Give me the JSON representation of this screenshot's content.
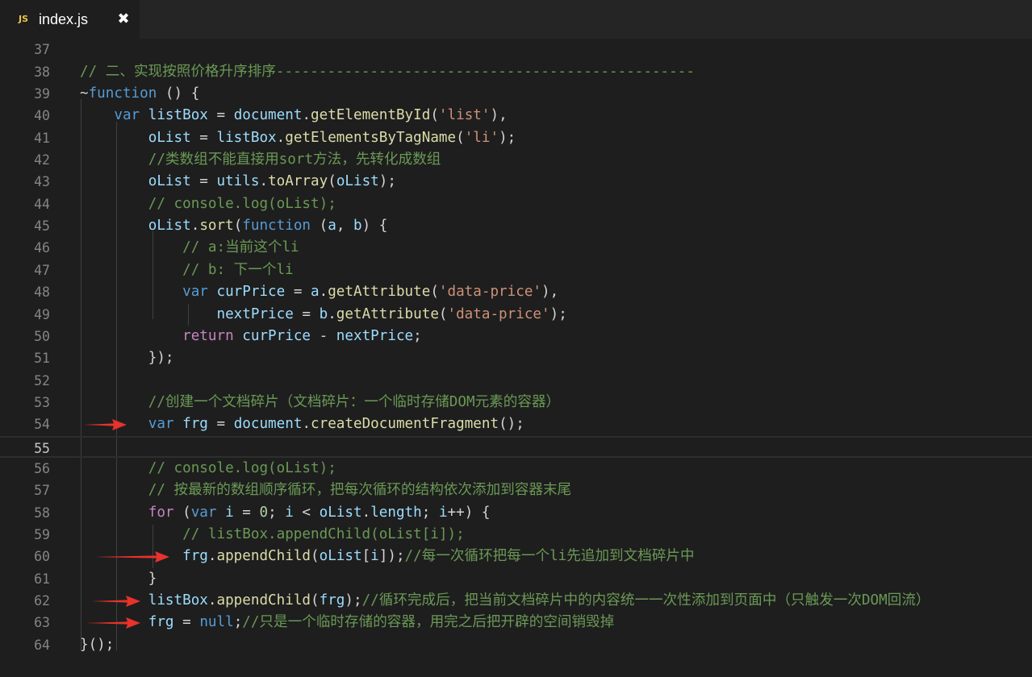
{
  "tab": {
    "icon": "JS",
    "title": "index.js",
    "close": "✖"
  },
  "colors": {
    "background": "#1e1e1e",
    "comment": "#6a9955",
    "keyword": "#569cd6",
    "control": "#c586c0",
    "variable": "#9cdcfe",
    "function": "#dcdcaa",
    "string": "#ce9178",
    "number": "#b5cea8",
    "arrow": "#e8322b"
  },
  "editor": {
    "current_line": 55,
    "arrow_lines": [
      54,
      60,
      62,
      63
    ],
    "lines": [
      {
        "n": "37",
        "tokens": []
      },
      {
        "n": "38",
        "tokens": [
          [
            "cm",
            "// 二、实现按照价格升序排序-------------------------------------------------"
          ]
        ]
      },
      {
        "n": "39",
        "tokens": [
          [
            "pl",
            "~"
          ],
          [
            "kw",
            "function"
          ],
          [
            "pl",
            " () {"
          ]
        ]
      },
      {
        "n": "40",
        "tokens": [
          [
            "pl",
            "    "
          ],
          [
            "kw",
            "var"
          ],
          [
            "pl",
            " "
          ],
          [
            "var",
            "listBox"
          ],
          [
            "pl",
            " = "
          ],
          [
            "var",
            "document"
          ],
          [
            "pl",
            "."
          ],
          [
            "fn",
            "getElementById"
          ],
          [
            "pl",
            "("
          ],
          [
            "str",
            "'list'"
          ],
          [
            "pl",
            "),"
          ]
        ]
      },
      {
        "n": "41",
        "tokens": [
          [
            "pl",
            "        "
          ],
          [
            "var",
            "oList"
          ],
          [
            "pl",
            " = "
          ],
          [
            "var",
            "listBox"
          ],
          [
            "pl",
            "."
          ],
          [
            "fn",
            "getElementsByTagName"
          ],
          [
            "pl",
            "("
          ],
          [
            "str",
            "'li'"
          ],
          [
            "pl",
            ");"
          ]
        ]
      },
      {
        "n": "42",
        "tokens": [
          [
            "pl",
            "        "
          ],
          [
            "cm",
            "//类数组不能直接用sort方法，先转化成数组"
          ]
        ]
      },
      {
        "n": "43",
        "tokens": [
          [
            "pl",
            "        "
          ],
          [
            "var",
            "oList"
          ],
          [
            "pl",
            " = "
          ],
          [
            "var",
            "utils"
          ],
          [
            "pl",
            "."
          ],
          [
            "fn",
            "toArray"
          ],
          [
            "pl",
            "("
          ],
          [
            "var",
            "oList"
          ],
          [
            "pl",
            ");"
          ]
        ]
      },
      {
        "n": "44",
        "tokens": [
          [
            "pl",
            "        "
          ],
          [
            "cm",
            "// console.log(oList);"
          ]
        ]
      },
      {
        "n": "45",
        "tokens": [
          [
            "pl",
            "        "
          ],
          [
            "var",
            "oList"
          ],
          [
            "pl",
            "."
          ],
          [
            "fn",
            "sort"
          ],
          [
            "pl",
            "("
          ],
          [
            "kw",
            "function"
          ],
          [
            "pl",
            " ("
          ],
          [
            "var",
            "a"
          ],
          [
            "pl",
            ", "
          ],
          [
            "var",
            "b"
          ],
          [
            "pl",
            ") {"
          ]
        ]
      },
      {
        "n": "46",
        "tokens": [
          [
            "pl",
            "            "
          ],
          [
            "cm",
            "// a:当前这个li"
          ]
        ]
      },
      {
        "n": "47",
        "tokens": [
          [
            "pl",
            "            "
          ],
          [
            "cm",
            "// b: 下一个li"
          ]
        ]
      },
      {
        "n": "48",
        "tokens": [
          [
            "pl",
            "            "
          ],
          [
            "kw",
            "var"
          ],
          [
            "pl",
            " "
          ],
          [
            "var",
            "curPrice"
          ],
          [
            "pl",
            " = "
          ],
          [
            "var",
            "a"
          ],
          [
            "pl",
            "."
          ],
          [
            "fn",
            "getAttribute"
          ],
          [
            "pl",
            "("
          ],
          [
            "str",
            "'data-price'"
          ],
          [
            "pl",
            "),"
          ]
        ]
      },
      {
        "n": "49",
        "tokens": [
          [
            "pl",
            "                "
          ],
          [
            "var",
            "nextPrice"
          ],
          [
            "pl",
            " = "
          ],
          [
            "var",
            "b"
          ],
          [
            "pl",
            "."
          ],
          [
            "fn",
            "getAttribute"
          ],
          [
            "pl",
            "("
          ],
          [
            "str",
            "'data-price'"
          ],
          [
            "pl",
            ");"
          ]
        ]
      },
      {
        "n": "50",
        "tokens": [
          [
            "pl",
            "            "
          ],
          [
            "ctl",
            "return"
          ],
          [
            "pl",
            " "
          ],
          [
            "var",
            "curPrice"
          ],
          [
            "pl",
            " - "
          ],
          [
            "var",
            "nextPrice"
          ],
          [
            "pl",
            ";"
          ]
        ]
      },
      {
        "n": "51",
        "tokens": [
          [
            "pl",
            "        });"
          ]
        ]
      },
      {
        "n": "52",
        "tokens": []
      },
      {
        "n": "53",
        "tokens": [
          [
            "pl",
            "        "
          ],
          [
            "cm",
            "//创建一个文档碎片（文档碎片：一个临时存储DOM元素的容器）"
          ]
        ]
      },
      {
        "n": "54",
        "tokens": [
          [
            "pl",
            "        "
          ],
          [
            "kw",
            "var"
          ],
          [
            "pl",
            " "
          ],
          [
            "var",
            "frg"
          ],
          [
            "pl",
            " = "
          ],
          [
            "var",
            "document"
          ],
          [
            "pl",
            "."
          ],
          [
            "fn",
            "createDocumentFragment"
          ],
          [
            "pl",
            "();"
          ]
        ]
      },
      {
        "n": "55",
        "tokens": []
      },
      {
        "n": "56",
        "tokens": [
          [
            "pl",
            "        "
          ],
          [
            "cm",
            "// console.log(oList);"
          ]
        ]
      },
      {
        "n": "57",
        "tokens": [
          [
            "pl",
            "        "
          ],
          [
            "cm",
            "// 按最新的数组顺序循环，把每次循环的结构依次添加到容器末尾"
          ]
        ]
      },
      {
        "n": "58",
        "tokens": [
          [
            "pl",
            "        "
          ],
          [
            "ctl",
            "for"
          ],
          [
            "pl",
            " ("
          ],
          [
            "kw",
            "var"
          ],
          [
            "pl",
            " "
          ],
          [
            "var",
            "i"
          ],
          [
            "pl",
            " = "
          ],
          [
            "num",
            "0"
          ],
          [
            "pl",
            "; "
          ],
          [
            "var",
            "i"
          ],
          [
            "pl",
            " < "
          ],
          [
            "var",
            "oList"
          ],
          [
            "pl",
            "."
          ],
          [
            "var",
            "length"
          ],
          [
            "pl",
            "; "
          ],
          [
            "var",
            "i"
          ],
          [
            "pl",
            "++) {"
          ]
        ]
      },
      {
        "n": "59",
        "tokens": [
          [
            "pl",
            "            "
          ],
          [
            "cm",
            "// listBox.appendChild(oList[i]);"
          ]
        ]
      },
      {
        "n": "60",
        "tokens": [
          [
            "pl",
            "            "
          ],
          [
            "var",
            "frg"
          ],
          [
            "pl",
            "."
          ],
          [
            "fn",
            "appendChild"
          ],
          [
            "pl",
            "("
          ],
          [
            "var",
            "oList"
          ],
          [
            "pl",
            "["
          ],
          [
            "var",
            "i"
          ],
          [
            "pl",
            "]);"
          ],
          [
            "cm",
            "//每一次循环把每一个li先追加到文档碎片中"
          ]
        ]
      },
      {
        "n": "61",
        "tokens": [
          [
            "pl",
            "        }"
          ]
        ]
      },
      {
        "n": "62",
        "tokens": [
          [
            "pl",
            "        "
          ],
          [
            "var",
            "listBox"
          ],
          [
            "pl",
            "."
          ],
          [
            "fn",
            "appendChild"
          ],
          [
            "pl",
            "("
          ],
          [
            "var",
            "frg"
          ],
          [
            "pl",
            ");"
          ],
          [
            "cm",
            "//循环完成后，把当前文档碎片中的内容统一一次性添加到页面中（只触发一次DOM回流）"
          ]
        ]
      },
      {
        "n": "63",
        "tokens": [
          [
            "pl",
            "        "
          ],
          [
            "var",
            "frg"
          ],
          [
            "pl",
            " = "
          ],
          [
            "kw",
            "null"
          ],
          [
            "pl",
            ";"
          ],
          [
            "cm",
            "//只是一个临时存储的容器，用完之后把开辟的空间销毁掉"
          ]
        ]
      },
      {
        "n": "64",
        "tokens": [
          [
            "pl",
            "}();"
          ]
        ]
      }
    ]
  }
}
